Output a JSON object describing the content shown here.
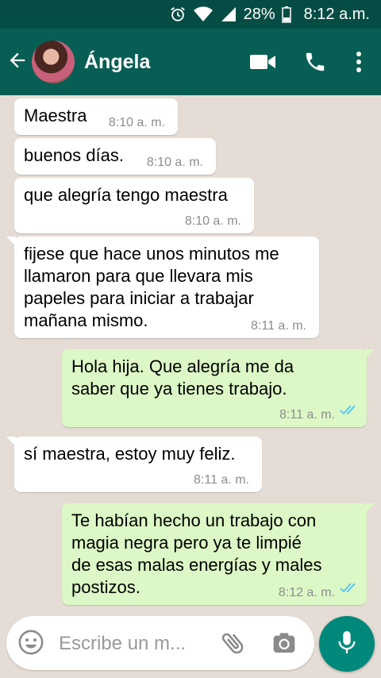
{
  "status_bar": {
    "battery_percent": "28%",
    "time": "8:12 a.m.",
    "icons": [
      "alarm-icon",
      "wifi-icon",
      "signal-icon",
      "battery-icon"
    ]
  },
  "header": {
    "contact_name": "Ángela",
    "icons": [
      "back-arrow-icon",
      "avatar",
      "video-call-icon",
      "phone-icon",
      "more-options-icon"
    ],
    "colors": {
      "header": "#075e54",
      "status_bar": "#054d44"
    }
  },
  "messages": [
    {
      "direction": "incoming",
      "text": "Maestra",
      "time": "8:10 a. m."
    },
    {
      "direction": "incoming",
      "text": "buenos días.",
      "time": "8:10 a. m."
    },
    {
      "direction": "incoming",
      "text": "que alegría tengo maestra",
      "time": "8:10 a. m."
    },
    {
      "direction": "incoming",
      "lines": [
        "fijese que hace unos minutos me",
        "llamaron para que llevara mis",
        "papeles para iniciar a trabajar",
        "mañana mismo."
      ],
      "time": "8:11 a. m."
    },
    {
      "direction": "outgoing",
      "lines": [
        "Hola hija. Que alegría me da",
        "saber que ya tienes trabajo."
      ],
      "time": "8:11 a. m.",
      "status": "read"
    },
    {
      "direction": "incoming",
      "text": "sí maestra, estoy muy feliz.",
      "time": "8:11 a. m."
    },
    {
      "direction": "outgoing",
      "lines": [
        "Te habían hecho un trabajo con",
        "magia negra pero ya te limpié",
        "de esas malas energías y males",
        "postizos."
      ],
      "time": "8:12 a. m.",
      "status": "read"
    }
  ],
  "input": {
    "placeholder": "Escribe un m...",
    "icons": [
      "emoji-icon",
      "attach-icon",
      "camera-icon",
      "mic-icon"
    ],
    "mic_color": "#00897b"
  }
}
